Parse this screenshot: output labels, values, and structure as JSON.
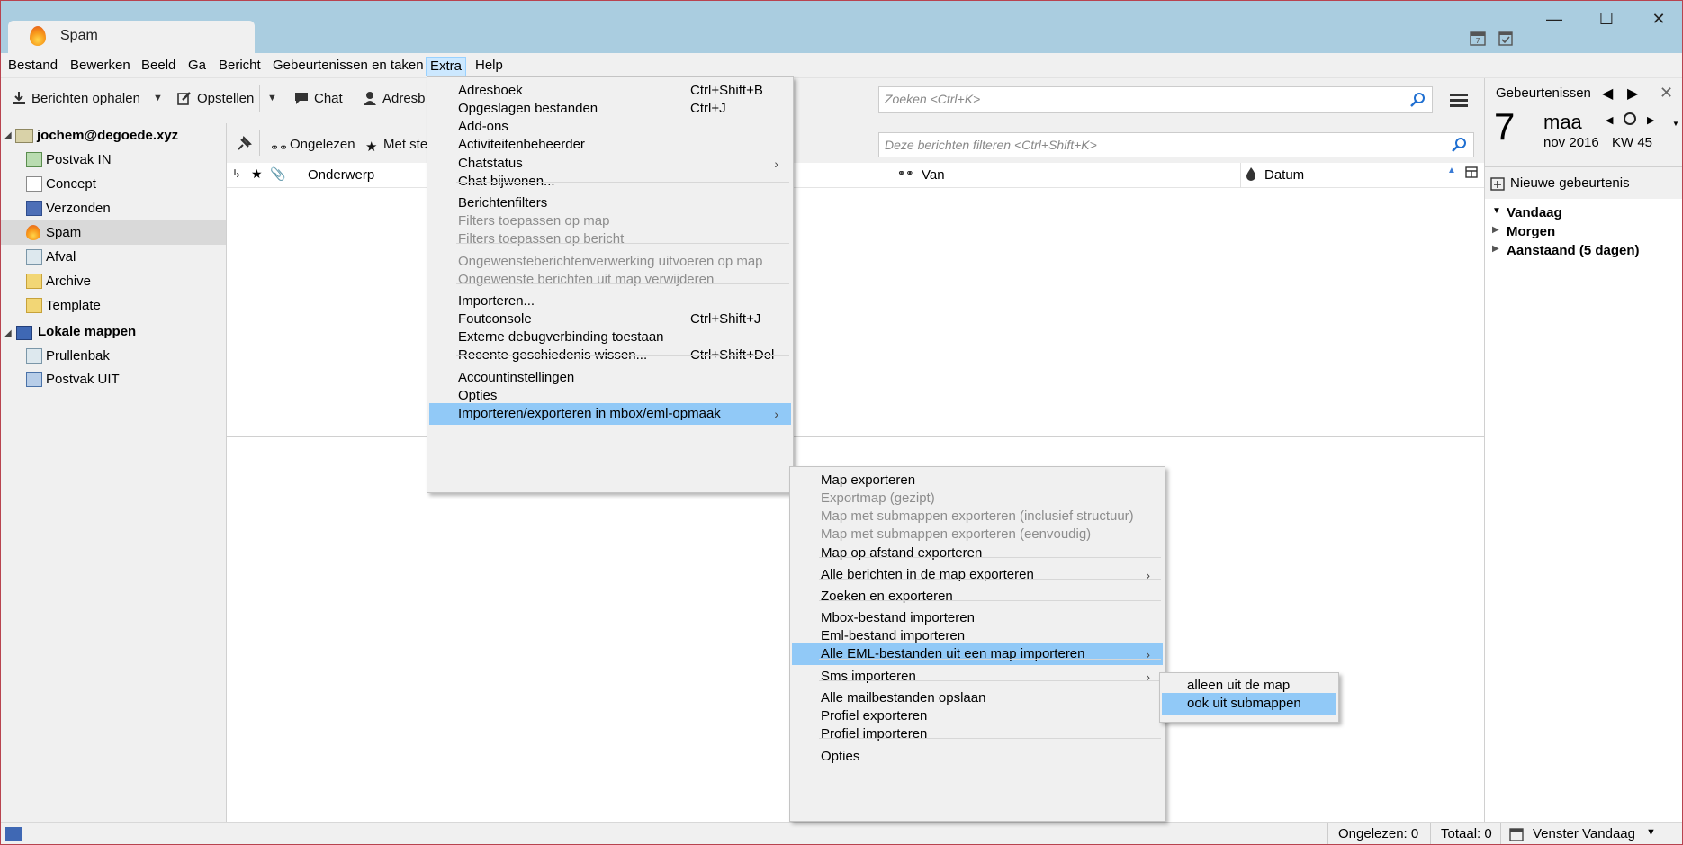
{
  "window": {
    "tab_title": "Spam"
  },
  "menubar": [
    "Bestand",
    "Bewerken",
    "Beeld",
    "Ga",
    "Bericht",
    "Gebeurtenissen en taken",
    "Extra",
    "Help"
  ],
  "toolbar": {
    "get_messages": "Berichten ophalen",
    "compose": "Opstellen",
    "chat": "Chat",
    "addressbook": "Adresb",
    "search_placeholder": "Zoeken <Ctrl+K>"
  },
  "filterbar": {
    "unread": "Ongelezen",
    "starred": "Met ste",
    "filter_placeholder": "Deze berichten filteren <Ctrl+Shift+K>"
  },
  "columns": {
    "subject": "Onderwerp",
    "from": "Van",
    "date": "Datum"
  },
  "folders": {
    "account1": "jochem@degoede.xyz",
    "items1": [
      "Postvak IN",
      "Concept",
      "Verzonden",
      "Spam",
      "Afval",
      "Archive",
      "Template"
    ],
    "account2": "Lokale mappen",
    "items2": [
      "Prullenbak",
      "Postvak UIT"
    ]
  },
  "extra_menu": [
    {
      "label": "Adresboek",
      "shortcut": "Ctrl+Shift+B"
    },
    {
      "label": "Opgeslagen bestanden",
      "shortcut": "Ctrl+J"
    },
    {
      "label": "Add-ons"
    },
    {
      "label": "Activiteitenbeheerder"
    },
    {
      "label": "Chatstatus",
      "submenu": true
    },
    {
      "label": "Chat bijwonen..."
    },
    {
      "label": "Berichtenfilters"
    },
    {
      "label": "Filters toepassen op map",
      "disabled": true
    },
    {
      "label": "Filters toepassen op bericht",
      "disabled": true
    },
    {
      "label": "Ongewensteberichtenverwerking uitvoeren op map",
      "disabled": true
    },
    {
      "label": "Ongewenste berichten uit map verwijderen",
      "disabled": true
    },
    {
      "label": "Importeren..."
    },
    {
      "label": "Foutconsole",
      "shortcut": "Ctrl+Shift+J"
    },
    {
      "label": "Externe debugverbinding toestaan"
    },
    {
      "label": "Recente geschiedenis wissen...",
      "shortcut": "Ctrl+Shift+Del"
    },
    {
      "label": "Accountinstellingen"
    },
    {
      "label": "Opties"
    },
    {
      "label": "Importeren/exporteren in mbox/eml-opmaak",
      "submenu": true,
      "highlighted": true
    }
  ],
  "mbox_menu": [
    {
      "label": "Map exporteren"
    },
    {
      "label": "Exportmap (gezipt)",
      "disabled": true
    },
    {
      "label": "Map met submappen exporteren (inclusief structuur)",
      "disabled": true
    },
    {
      "label": "Map met submappen exporteren (eenvoudig)",
      "disabled": true
    },
    {
      "label": "Map op afstand exporteren"
    },
    {
      "label": "Alle berichten in de map exporteren",
      "submenu": true
    },
    {
      "label": "Zoeken en exporteren"
    },
    {
      "label": "Mbox-bestand importeren"
    },
    {
      "label": "Eml-bestand importeren"
    },
    {
      "label": "Alle EML-bestanden uit een map importeren",
      "submenu": true,
      "highlighted": true
    },
    {
      "label": "Sms importeren",
      "submenu": true
    },
    {
      "label": "Alle mailbestanden opslaan"
    },
    {
      "label": "Profiel exporteren"
    },
    {
      "label": "Profiel importeren"
    },
    {
      "label": "Opties"
    }
  ],
  "eml_menu": [
    {
      "label": "alleen uit de map"
    },
    {
      "label": "ook uit submappen",
      "highlighted": true
    }
  ],
  "events": {
    "header": "Gebeurtenissen",
    "day": "7",
    "weekday": "maa",
    "month_year": "nov 2016",
    "week": "KW 45",
    "new_event": "Nieuwe gebeurtenis",
    "groups": [
      "Vandaag",
      "Morgen",
      "Aanstaand (5 dagen)"
    ]
  },
  "status": {
    "unread": "Ongelezen: 0",
    "total": "Totaal: 0",
    "today_pane": "Venster Vandaag"
  },
  "colors": {
    "titlebar": "#aacde0",
    "menu_highlight": "#91c9f7",
    "chrome": "#f0f0f0"
  }
}
